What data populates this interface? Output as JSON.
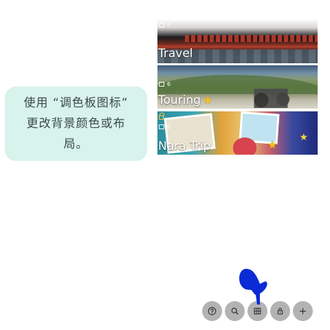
{
  "tooltip": {
    "text": "使用 “调色板图标” 更改背景颜色或布局。"
  },
  "albums": [
    {
      "title": "Travel",
      "photo_count": "5",
      "favorite": false,
      "locked": false
    },
    {
      "title": "Touring",
      "photo_count": "6",
      "favorite": true,
      "locked": false
    },
    {
      "title": "Nara Trip",
      "photo_count": "0",
      "favorite": true,
      "locked": true
    }
  ],
  "toolbar": {
    "buttons": [
      {
        "name": "help",
        "icon": "help-circle-icon"
      },
      {
        "name": "search",
        "icon": "search-icon"
      },
      {
        "name": "layout",
        "icon": "grid-icon"
      },
      {
        "name": "lock",
        "icon": "lock-icon"
      },
      {
        "name": "add",
        "label": "+",
        "icon": "plus-icon"
      }
    ]
  },
  "colors": {
    "tooltip_bg": "#d8f2ec",
    "toolbar_button": "#b3b3b3",
    "pointer_hand": "#0a2bd6",
    "favorite_star": "#f6c21a"
  }
}
